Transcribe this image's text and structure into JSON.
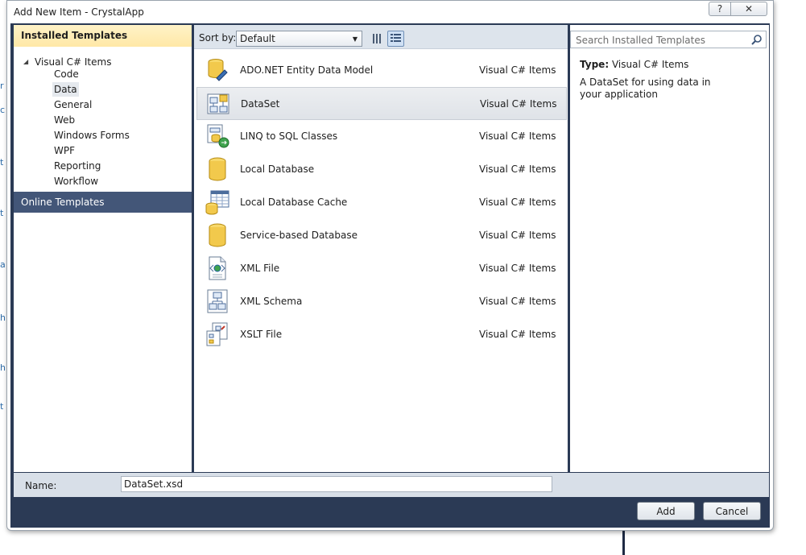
{
  "window": {
    "title": "Add New Item - CrystalApp",
    "help_label": "?",
    "close_label": "✕"
  },
  "left_panel": {
    "installed_header": "Installed Templates",
    "tree_root": "Visual C# Items",
    "tree_items": [
      {
        "label": "Code"
      },
      {
        "label": "Data"
      },
      {
        "label": "General"
      },
      {
        "label": "Web"
      },
      {
        "label": "Windows Forms"
      },
      {
        "label": "WPF"
      },
      {
        "label": "Reporting"
      },
      {
        "label": "Workflow"
      }
    ],
    "selected_item": "Data",
    "online_header": "Online Templates"
  },
  "toolbar": {
    "sort_label": "Sort by:",
    "sort_value": "Default"
  },
  "templates": [
    {
      "name": "ADO.NET Entity Data Model",
      "category": "Visual C# Items",
      "icon": "entity-model-icon"
    },
    {
      "name": "DataSet",
      "category": "Visual C# Items",
      "icon": "dataset-icon"
    },
    {
      "name": "LINQ to SQL Classes",
      "category": "Visual C# Items",
      "icon": "linq-to-sql-icon"
    },
    {
      "name": "Local Database",
      "category": "Visual C# Items",
      "icon": "database-icon"
    },
    {
      "name": "Local Database Cache",
      "category": "Visual C# Items",
      "icon": "database-cache-icon"
    },
    {
      "name": "Service-based Database",
      "category": "Visual C# Items",
      "icon": "database-icon"
    },
    {
      "name": "XML File",
      "category": "Visual C# Items",
      "icon": "xml-file-icon"
    },
    {
      "name": "XML Schema",
      "category": "Visual C# Items",
      "icon": "xml-schema-icon"
    },
    {
      "name": "XSLT File",
      "category": "Visual C# Items",
      "icon": "xslt-file-icon"
    }
  ],
  "selected_template": "DataSet",
  "details": {
    "search_placeholder": "Search Installed Templates",
    "type_label": "Type:",
    "type_value": "Visual C# Items",
    "description": "A DataSet for using data in your application"
  },
  "name_row": {
    "label": "Name:",
    "value": "DataSet.xsd"
  },
  "buttons": {
    "add": "Add",
    "cancel": "Cancel"
  },
  "colors": {
    "frame_navy": "#2b3a55",
    "online_header": "#435678",
    "installed_header": "#ffe8a6",
    "selection_bg": "#e5e9ee"
  }
}
